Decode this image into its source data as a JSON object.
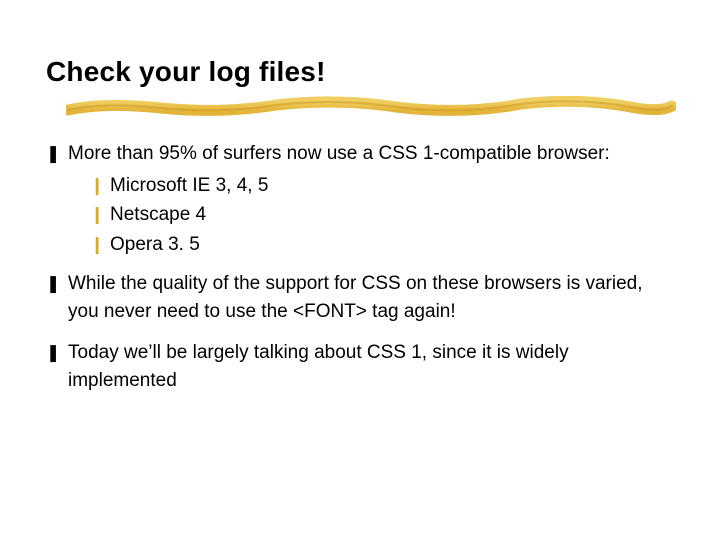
{
  "title": "Check your log files!",
  "bullets": [
    {
      "text": "More than 95% of surfers now use a CSS 1-compatible browser:",
      "sub": [
        "Microsoft IE 3, 4, 5",
        "Netscape 4",
        "Opera 3. 5"
      ]
    },
    {
      "text": "While the quality of the support for CSS on these browsers is varied, you never need to use the <FONT> tag again!"
    },
    {
      "text": "Today we’ll be largely talking about CSS 1, since it is widely implemented"
    }
  ]
}
